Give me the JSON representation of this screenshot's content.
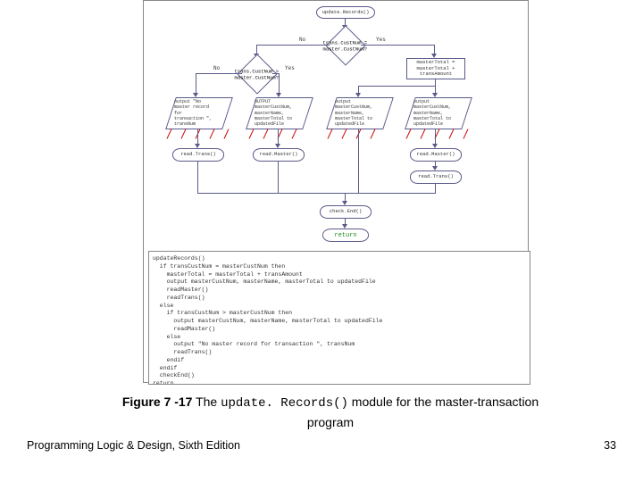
{
  "figure": {
    "number": "Figure 7 -17",
    "text_before": " The ",
    "code": "update. Records()",
    "text_after": " module for the master-transaction",
    "line2": "program"
  },
  "footer": {
    "left": "Programming Logic & Design, Sixth Edition",
    "page": "33"
  },
  "flow": {
    "start": "update.Records()",
    "d1": "trans.CustNum = master.CustNum?",
    "yes": "Yes",
    "no": "No",
    "right_box": "masterTotal = masterTotal + transAmount",
    "d2": "trans.CustNum > master.CustNum?",
    "p1": "output \"No\\nmaster record\\nfor\\ntransaction \",\\ntransNum",
    "p2": "OUTPUT\\nmasterCustNum,\\nmasterName,\\nmasterTotal to\\nupdatedFile",
    "p3": "output\\nmasterCustNum,\\nmasterName,\\nmasterTotal to\\nupdatedFile",
    "b_rt": "read.Trans()",
    "b_rm1": "read.Master()",
    "b_rm2": "read.Master()",
    "b_rt2": "read.Trans()",
    "b_check": "check.End()",
    "return": "return"
  },
  "pseudo": "updateRecords()\n  if transCustNum = masterCustNum then\n    masterTotal = masterTotal + transAmount\n    output masterCustNum, masterName, masterTotal to updatedFile\n    readMaster()\n    readTrans()\n  else\n    if transCustNum > masterCustNum then\n      output masterCustNum, masterName, masterTotal to updatedFile\n      readMaster()\n    else\n      output \"No master record for transaction \", transNum\n      readTrans()\n    endif\n  endif\n  checkEnd()\nreturn"
}
